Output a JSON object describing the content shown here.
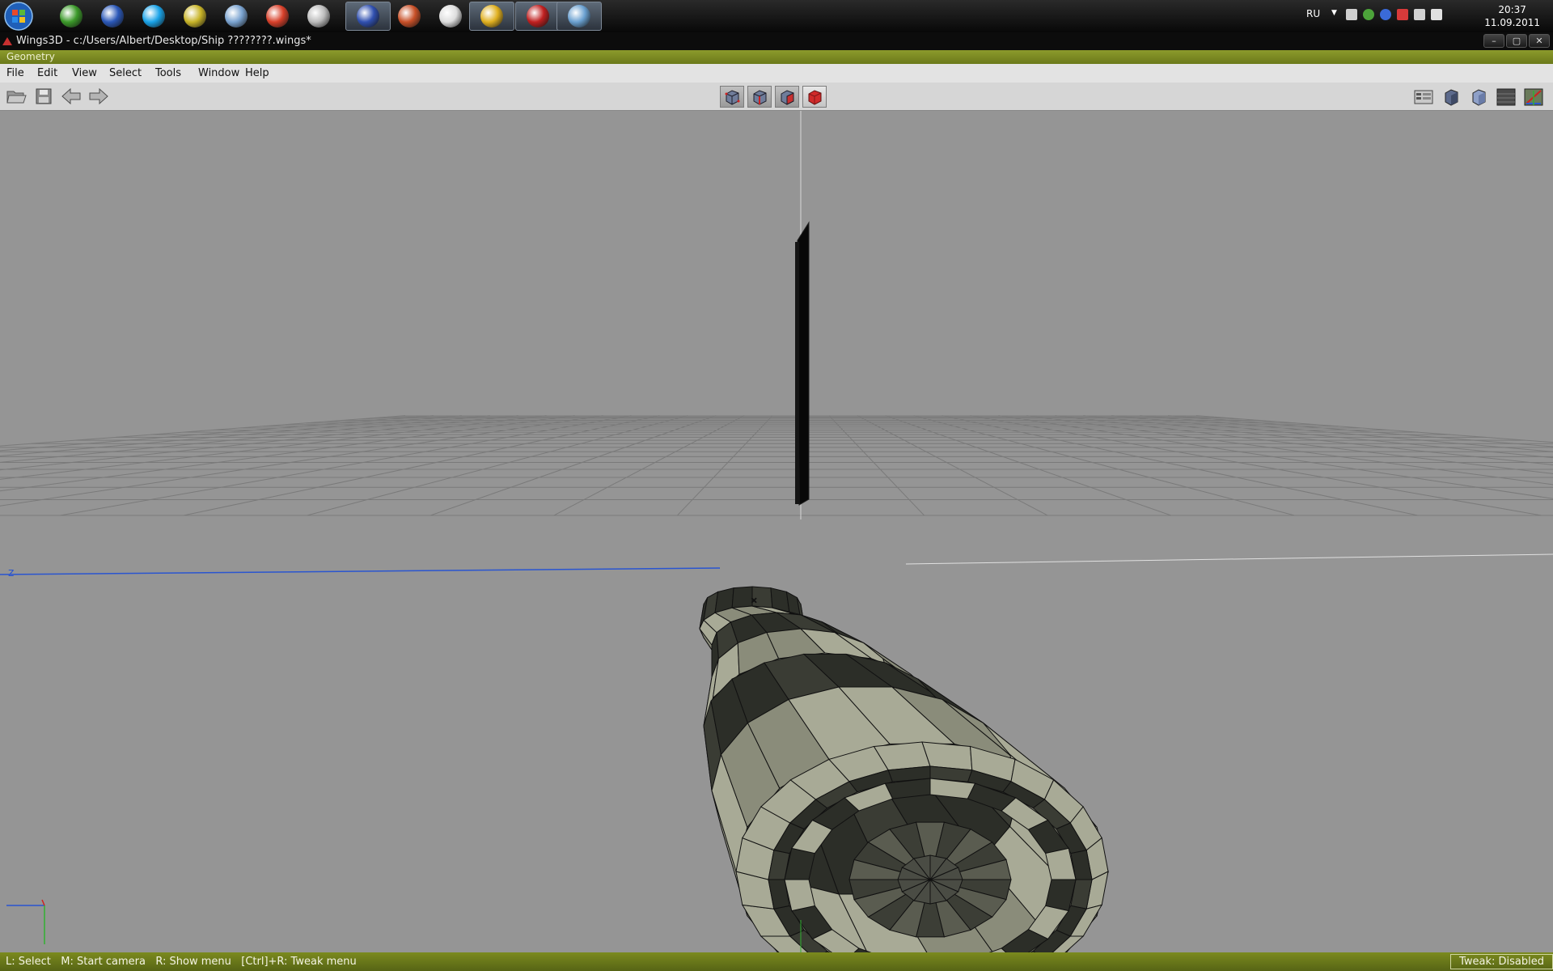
{
  "taskbar": {
    "apps": [
      {
        "name": "utorrent-icon",
        "color": "#3c9a2a"
      },
      {
        "name": "google-earth-icon",
        "color": "#2b58b8"
      },
      {
        "name": "skype-icon",
        "color": "#1aa3e8"
      },
      {
        "name": "robot-app-icon",
        "color": "#c8b428"
      },
      {
        "name": "tools-app-icon",
        "color": "#7aa3d0"
      },
      {
        "name": "red-swirl-app-icon",
        "color": "#d8402a"
      },
      {
        "name": "speaker-app-icon",
        "color": "#bbbbbb"
      },
      {
        "name": "floppy-disk-icon",
        "color": "#3050b0"
      },
      {
        "name": "firewall-app-icon",
        "color": "#c85028"
      },
      {
        "name": "skull-app-icon",
        "color": "#dddddd"
      },
      {
        "name": "chrome-icon",
        "color": "#e0b020"
      },
      {
        "name": "erlang-icon",
        "color": "#c02020"
      },
      {
        "name": "paint-app-icon",
        "color": "#6aa0d0"
      }
    ],
    "language": "RU",
    "time": "20:37",
    "date": "11.09.2011"
  },
  "window": {
    "title": "Wings3D - c:/Users/Albert/Desktop/Ship ????????.wings*",
    "minimize": "–",
    "maximize": "▢",
    "close": "✕"
  },
  "geometry_label": "Geometry",
  "menu": [
    "File",
    "Edit",
    "View",
    "Select",
    "Tools",
    "Window",
    "Help"
  ],
  "viewport": {
    "axis_label": "z"
  },
  "status": {
    "hints": "L: Select   M: Start camera   R: Show menu   [Ctrl]+R: Tweak menu",
    "tweak": "Tweak: Disabled"
  },
  "colors": {
    "accent": "#7b8a1e",
    "viewport": "#959595",
    "mesh_light": "#a8aa96",
    "mesh_dark": "#2c2e28"
  }
}
